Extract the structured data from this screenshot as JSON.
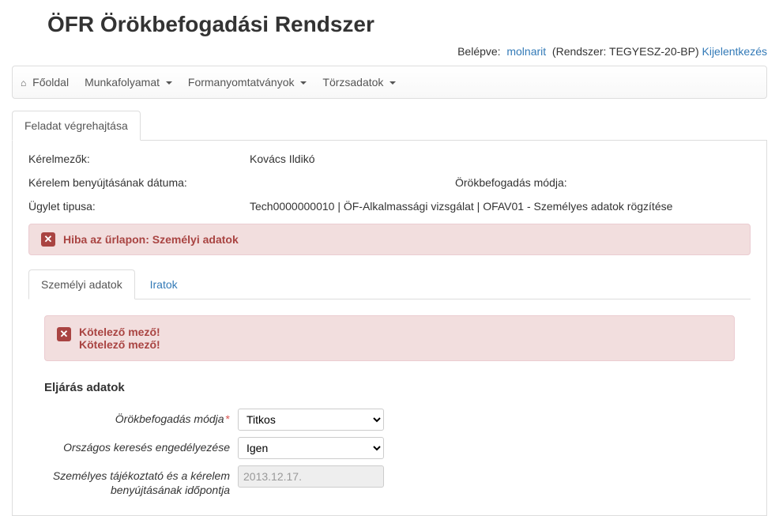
{
  "app": {
    "title": "ÖFR Örökbefogadási Rendszer"
  },
  "user": {
    "logged_in_label": "Belépve:",
    "username": "molnarit",
    "system_label": "(Rendszer: TEGYESZ-20-BP)",
    "logout": "Kijelentkezés"
  },
  "nav": {
    "home": "Főoldal",
    "items": [
      "Munkafolyamat",
      "Formanyomtatványok",
      "Törzsadatok"
    ]
  },
  "main_tab": "Feladat végrehajtása",
  "summary": {
    "applicants_label": "Kérelmezők:",
    "applicants_value": "Kovács Ildikó",
    "submission_date_label": "Kérelem benyújtásának dátuma:",
    "adoption_mode_label": "Örökbefogadás módja:",
    "case_type_label": "Ügylet tipusa:",
    "case_type_value": "Tech0000000010 | ÖF-Alkalmassági vizsgálat | OFAV01 - Személyes adatok rögzítése"
  },
  "error_banner": "Hiba az űrlapon: Személyi adatok",
  "inner_tabs": {
    "personal": "Személyi adatok",
    "documents": "Iratok"
  },
  "inner_error": {
    "line1": "Kötelező mező!",
    "line2": "Kötelező mező!"
  },
  "form": {
    "section_title": "Eljárás adatok",
    "adoption_mode": {
      "label": "Örökbefogadás módja",
      "value": "Titkos",
      "options": [
        "Titkos"
      ]
    },
    "national_search": {
      "label": "Országos keresés engedélyezése",
      "value": "Igen",
      "options": [
        "Igen"
      ]
    },
    "submission_time": {
      "label": "Személyes tájékoztató és a kérelem benyújtásának időpontja",
      "value": "2013.12.17."
    }
  }
}
